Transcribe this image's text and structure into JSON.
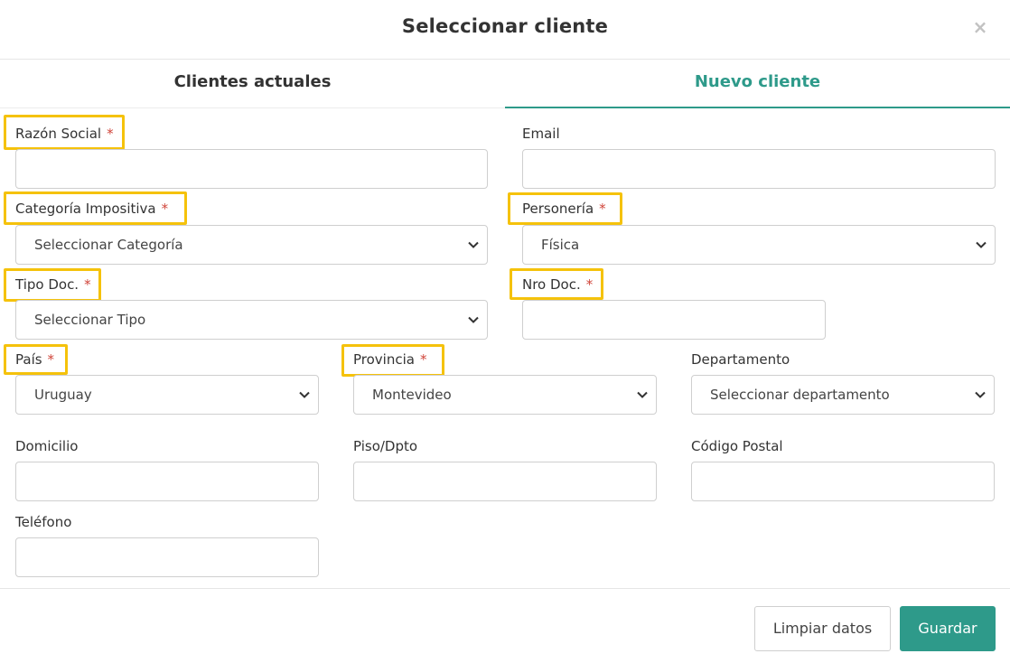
{
  "modal": {
    "title": "Seleccionar cliente",
    "close_label": "×"
  },
  "tabs": [
    {
      "label": "Clientes actuales",
      "active": false
    },
    {
      "label": "Nuevo cliente",
      "active": true
    }
  ],
  "form": {
    "razon_social": {
      "label": "Razón Social",
      "required": "*",
      "value": ""
    },
    "email": {
      "label": "Email",
      "value": ""
    },
    "categoria": {
      "label": "Categoría Impositiva",
      "required": "*",
      "selected": "Seleccionar Categoría"
    },
    "personeria": {
      "label": "Personería",
      "required": "*",
      "selected": "Física"
    },
    "tipo_doc": {
      "label": "Tipo Doc.",
      "required": "*",
      "selected": "Seleccionar Tipo"
    },
    "nro_doc": {
      "label": "Nro Doc.",
      "required": "*",
      "value": ""
    },
    "pais": {
      "label": "País",
      "required": "*",
      "selected": "Uruguay"
    },
    "provincia": {
      "label": "Provincia",
      "required": "*",
      "selected": "Montevideo"
    },
    "departamento": {
      "label": "Departamento",
      "selected": "Seleccionar departamento"
    },
    "domicilio": {
      "label": "Domicilio",
      "value": ""
    },
    "piso": {
      "label": "Piso/Dpto",
      "value": ""
    },
    "codigo_postal": {
      "label": "Código Postal",
      "value": ""
    },
    "telefono": {
      "label": "Teléfono",
      "value": ""
    }
  },
  "footer": {
    "clear_label": "Limpiar datos",
    "save_label": "Guardar"
  },
  "colors": {
    "accent": "#2e9a8a",
    "required": "#d0453a",
    "highlight": "#f5c20b"
  }
}
